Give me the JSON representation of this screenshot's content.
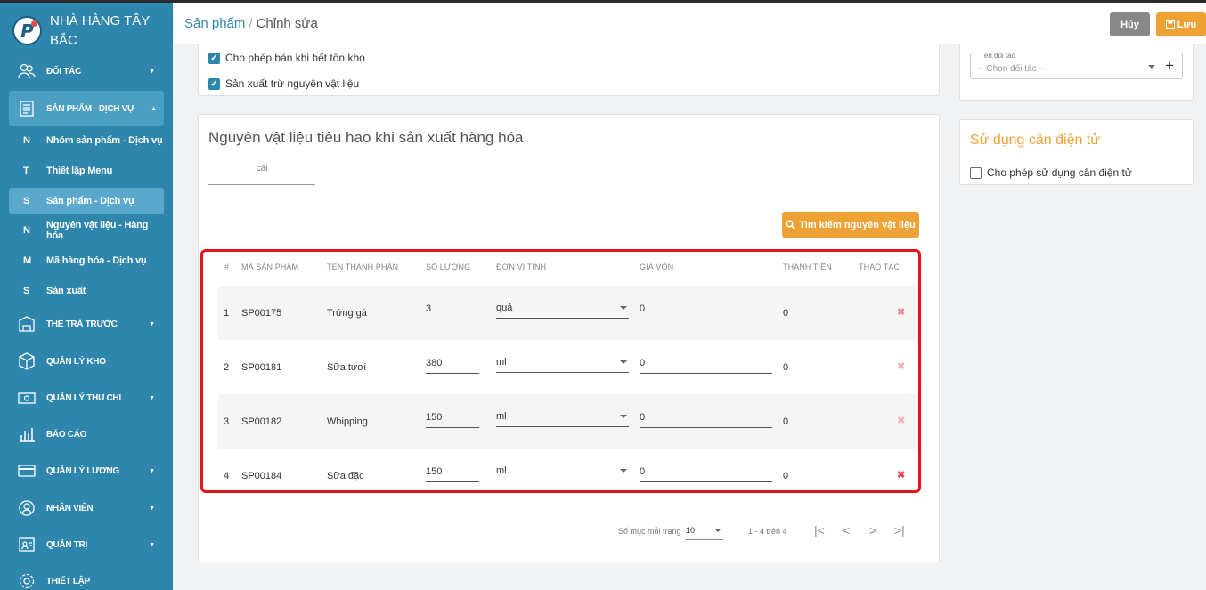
{
  "brand": {
    "name": "NHÀ HÀNG TÂY BẮC",
    "logo_letter": "P"
  },
  "sidebar": {
    "items": [
      {
        "label": "ĐỐI TÁC",
        "icon": "partner-icon",
        "caret": true
      },
      {
        "label": "SẢN PHẨM - DỊCH VỤ",
        "icon": "product-icon",
        "caret": true,
        "active": true
      },
      {
        "label": "THẺ TRẢ TRƯỚC",
        "icon": "prepaid-card-icon",
        "caret": true
      },
      {
        "label": "QUẢN LÝ KHO",
        "icon": "warehouse-icon",
        "caret": false
      },
      {
        "label": "QUẢN LÝ THU CHI",
        "icon": "cash-icon",
        "caret": true
      },
      {
        "label": "BÁO CÁO",
        "icon": "report-icon",
        "caret": false
      },
      {
        "label": "QUẢN LÝ LƯƠNG",
        "icon": "salary-icon",
        "caret": true
      },
      {
        "label": "NHÂN VIÊN",
        "icon": "employee-icon",
        "caret": true
      },
      {
        "label": "QUẢN TRỊ",
        "icon": "admin-icon",
        "caret": true
      },
      {
        "label": "THIẾT LẬP",
        "icon": "settings-icon",
        "caret": false
      }
    ],
    "subitems": [
      {
        "key": "N",
        "label": "Nhóm sản phẩm - Dịch vụ"
      },
      {
        "key": "T",
        "label": "Thiết lập Menu"
      },
      {
        "key": "S",
        "label": "Sản phẩm - Dịch vụ",
        "active": true
      },
      {
        "key": "N",
        "label": "Nguyên vật liệu - Hàng hóa"
      },
      {
        "key": "M",
        "label": "Mã hàng hóa - Dịch vụ"
      },
      {
        "key": "S",
        "label": "Sản xuất"
      }
    ]
  },
  "header": {
    "breadcrumb_1": "Sản phẩm",
    "breadcrumb_sep": "/",
    "breadcrumb_2": "Chỉnh sửa",
    "cancel_label": "Hủy",
    "save_label": "Lưu"
  },
  "options": {
    "allow_sell_out_of_stock": "Cho phép bán khi hết tồn kho",
    "deduct_materials": "Sản xuất trừ nguyên vật liệu"
  },
  "materials": {
    "title": "Nguyên vật liệu tiêu hao khi sản xuất hàng hóa",
    "unit_value": "cái",
    "search_button": "Tìm kiếm nguyên vật liệu",
    "columns": [
      "#",
      "MÃ SẢN PHẨM",
      "TÊN THÀNH PHẦN",
      "SỐ LƯỢNG",
      "ĐƠN VỊ TÍNH",
      "GIÁ VỐN",
      "THÀNH TIỀN",
      "THAO TÁC"
    ],
    "rows": [
      {
        "idx": "1",
        "code": "SP00175",
        "name": "Trứng gà",
        "qty": "3",
        "unit": "quả",
        "cost": "0",
        "total": "0"
      },
      {
        "idx": "2",
        "code": "SP00181",
        "name": "Sữa tươi",
        "qty": "380",
        "unit": "ml",
        "cost": "0",
        "total": "0"
      },
      {
        "idx": "3",
        "code": "SP00182",
        "name": "Whipping",
        "qty": "150",
        "unit": "ml",
        "cost": "0",
        "total": "0"
      },
      {
        "idx": "4",
        "code": "SP00184",
        "name": "Sữa đặc",
        "qty": "150",
        "unit": "ml",
        "cost": "0",
        "total": "0"
      }
    ],
    "pager": {
      "per_page_label": "Số mục mỗi trang",
      "per_page": "10",
      "range": "1 - 4 trên 4"
    }
  },
  "partner": {
    "label": "Tên đối tác",
    "placeholder": "-- Chọn đối tác --"
  },
  "scale": {
    "title": "Sử dụng cân điện tử",
    "option": "Cho phép sử dụng cân điện tử"
  },
  "colors": {
    "sidebar": "#2f86ad",
    "accent": "#eea236",
    "highlight": "#e3141b",
    "delete": "#e35d6a"
  }
}
